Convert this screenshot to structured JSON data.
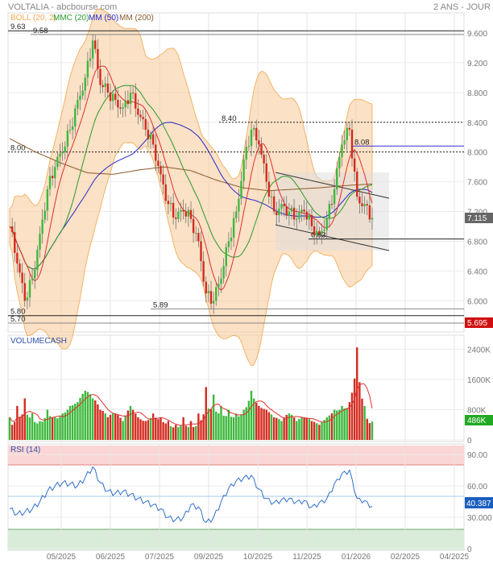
{
  "header": {
    "title": "VOLTALIA - abcbourse.com",
    "period": "2 ANS - JOUR"
  },
  "legend": [
    {
      "label": "BOLL (20, 2)",
      "color": "#f0a850"
    },
    {
      "label": "MMC (20)",
      "color": "#2a9a2a"
    },
    {
      "label": "MM (50)",
      "color": "#2626c8"
    },
    {
      "label": "MM (200)",
      "color": "#8a5a2a"
    }
  ],
  "chart_data": [
    {
      "type": "candlestick",
      "title": "VOLTALIA",
      "ylim": [
        5.6,
        9.7
      ],
      "yticks": [
        "9.600",
        "9.200",
        "8.800",
        "8.400",
        "8.000",
        "7.600",
        "7.200",
        "6.800",
        "6.400",
        "6.000"
      ],
      "ytick_values": [
        9.6,
        9.2,
        8.8,
        8.4,
        8.0,
        7.6,
        7.2,
        6.8,
        6.4,
        6.0
      ],
      "closes": [
        7.0,
        6.5,
        6.0,
        6.3,
        6.9,
        7.5,
        7.8,
        8.0,
        8.3,
        8.7,
        9.0,
        9.5,
        8.9,
        8.8,
        8.7,
        8.6,
        8.8,
        8.5,
        8.3,
        8.1,
        7.7,
        7.3,
        7.1,
        7.2,
        7.1,
        6.8,
        6.1,
        6.0,
        6.3,
        6.8,
        7.2,
        7.9,
        8.3,
        8.1,
        7.6,
        7.2,
        7.3,
        7.2,
        7.1,
        7.2,
        7.0,
        6.9,
        7.1,
        7.5,
        8.1,
        8.3,
        7.4,
        7.3,
        7.115
      ],
      "mm200": [
        8.18,
        8.0,
        7.85,
        7.72,
        7.7,
        7.76,
        7.8,
        7.75,
        7.62,
        7.52,
        7.48,
        7.5,
        7.52,
        7.55,
        7.57
      ],
      "levels": [
        {
          "label": "9.63",
          "value": 9.63,
          "color": "#222",
          "style": "solid"
        },
        {
          "label": "9.58",
          "value": 9.58,
          "color": "#888",
          "style": "solid"
        },
        {
          "label": "8.40",
          "value": 8.4,
          "color": "#222",
          "style": "dotted"
        },
        {
          "label": "8.00",
          "value": 8.0,
          "color": "#222",
          "style": "dotted"
        },
        {
          "label": "8.08",
          "value": 8.08,
          "color": "#3333cc",
          "style": "solid"
        },
        {
          "label": "6.83",
          "value": 6.83,
          "color": "#222",
          "style": "solid"
        },
        {
          "label": "5.89",
          "value": 5.89,
          "color": "#888",
          "style": "solid"
        },
        {
          "label": "5.80",
          "value": 5.8,
          "color": "#222",
          "style": "solid"
        },
        {
          "label": "5.70",
          "value": 5.7,
          "color": "#888",
          "style": "solid"
        }
      ],
      "last_price": "7.115",
      "alert_price": "5.695"
    },
    {
      "type": "bar",
      "title": "VOLUMECASH",
      "unit": "K",
      "yticks": [
        "2400K",
        "1600K",
        "800K",
        "0"
      ],
      "ytick_values": [
        2400,
        1600,
        800,
        0
      ],
      "values": [
        600,
        900,
        1100,
        700,
        500,
        800,
        600,
        700,
        900,
        1000,
        1300,
        1100,
        800,
        600,
        700,
        500,
        900,
        600,
        500,
        700,
        600,
        500,
        400,
        600,
        500,
        700,
        1400,
        1200,
        900,
        800,
        700,
        800,
        1300,
        900,
        800,
        600,
        500,
        700,
        500,
        600,
        500,
        400,
        600,
        800,
        900,
        1000,
        2450,
        900,
        486
      ],
      "last_value": "486K"
    },
    {
      "type": "line",
      "title": "RSI (14)",
      "ylim": [
        0,
        100
      ],
      "yticks": [
        "90.00",
        "60.00",
        "30.000",
        "0"
      ],
      "ytick_values": [
        90,
        60,
        30,
        0
      ],
      "overbought": 80,
      "oversold": 20,
      "values": [
        38,
        33,
        35,
        38,
        45,
        55,
        60,
        63,
        62,
        60,
        68,
        78,
        63,
        55,
        53,
        55,
        52,
        48,
        45,
        42,
        38,
        30,
        28,
        30,
        42,
        40,
        25,
        30,
        45,
        58,
        65,
        68,
        70,
        57,
        48,
        44,
        47,
        48,
        45,
        46,
        40,
        44,
        48,
        62,
        72,
        75,
        48,
        46,
        40.387
      ],
      "last_value": "40.387"
    }
  ],
  "xaxis": {
    "labels": [
      "05/2025",
      "06/2025",
      "07/2025",
      "09/2025",
      "10/2025",
      "11/2025",
      "01/2026",
      "02/2025",
      "04/2025"
    ]
  },
  "colors": {
    "up": "#3cb83c",
    "down": "#d42a1e",
    "boll": "#f7c896",
    "rsi": "#2f6fc8"
  }
}
